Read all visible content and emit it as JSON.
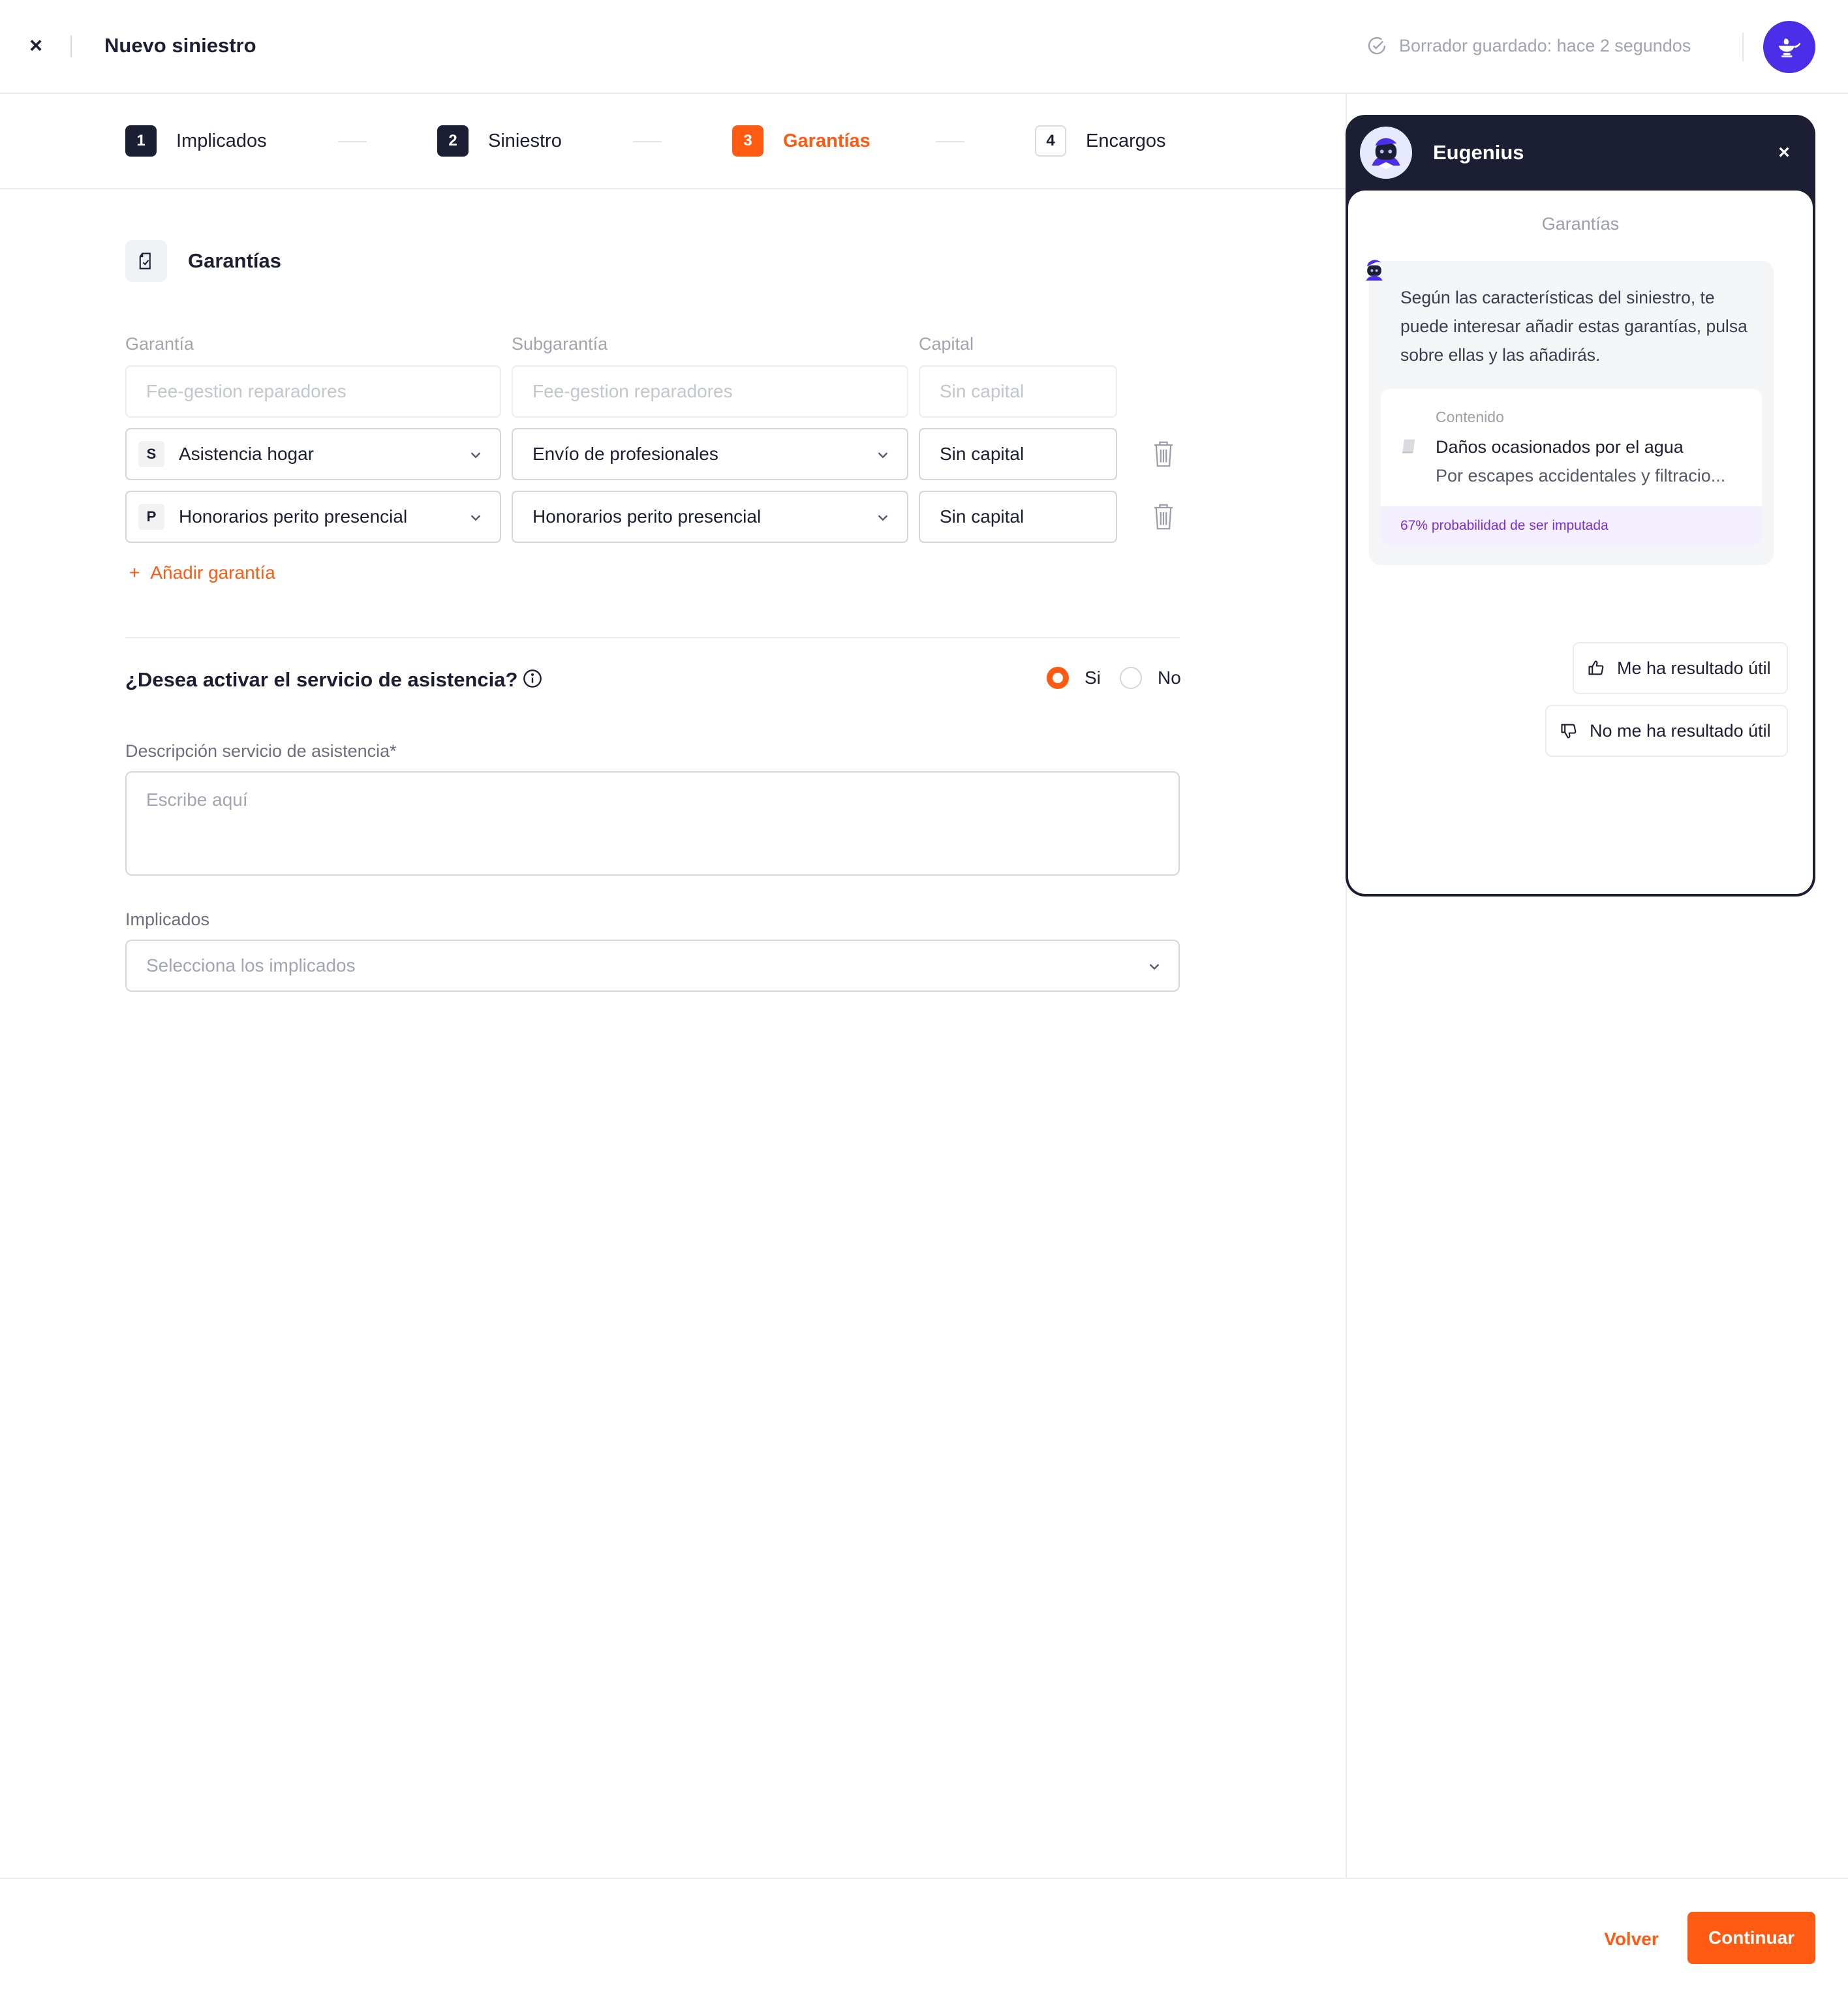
{
  "header": {
    "title": "Nuevo siniestro",
    "save_status": "Borrador guardado: hace 2 segundos"
  },
  "stepper": {
    "steps": [
      {
        "num": "1",
        "label": "Implicados",
        "state": "done"
      },
      {
        "num": "2",
        "label": "Siniestro",
        "state": "done"
      },
      {
        "num": "3",
        "label": "Garantías",
        "state": "active"
      },
      {
        "num": "4",
        "label": "Encargos",
        "state": "todo"
      }
    ]
  },
  "section": {
    "title": "Garantías",
    "columns": {
      "garantia": "Garantía",
      "subgarantia": "Subgarantía",
      "capital": "Capital"
    },
    "placeholder_row": {
      "garantia": "Fee-gestion reparadores",
      "subgarantia": "Fee-gestion reparadores",
      "capital": "Sin capital"
    },
    "rows": [
      {
        "badge": "S",
        "garantia": "Asistencia hogar",
        "subgarantia": "Envío de profesionales",
        "capital": "Sin capital"
      },
      {
        "badge": "P",
        "garantia": "Honorarios perito presencial",
        "subgarantia": "Honorarios perito presencial",
        "capital": "Sin capital"
      }
    ],
    "add_label": "Añadir garantía",
    "add_symbol": "+"
  },
  "assistance": {
    "question": "¿Desea activar el servicio de asistencia?",
    "options": [
      "Si",
      "No"
    ],
    "selected": "Si",
    "description_label": "Descripción servicio de asistencia*",
    "description_placeholder": "Escribe aquí",
    "implicados_label": "Implicados",
    "implicados_placeholder": "Selecciona los implicados"
  },
  "footer": {
    "back_label": "Volver",
    "continue_label": "Continuar"
  },
  "assistant": {
    "name": "Eugenius",
    "topic": "Garantías",
    "message": "Según las características del siniestro, te puede interesar añadir estas garantías, pulsa sobre ellas y las añadirás.",
    "suggestion": {
      "category": "Contenido",
      "title": "Daños ocasionados por el agua",
      "subtitle": "Por escapes accidentales y filtracio...",
      "probability": "67% probabilidad de ser imputada"
    },
    "feedback_positive": "Me ha resultado útil",
    "feedback_negative": "No me ha resultado útil"
  },
  "colors": {
    "accent": "#ff5a12",
    "dark": "#1c1f33",
    "brand_purple": "#4a2ee8",
    "probability_text": "#7a2ee0"
  },
  "icons": {
    "close": "close-icon",
    "saved": "check-circle-icon",
    "avatar": "genie-lamp-icon",
    "section": "document-check-icon",
    "delete": "trash-icon",
    "info": "info-icon",
    "dropdown": "chevron-down-icon",
    "suggestion": "document-icon",
    "like": "thumbs-up-icon",
    "dislike": "thumbs-down-icon"
  }
}
